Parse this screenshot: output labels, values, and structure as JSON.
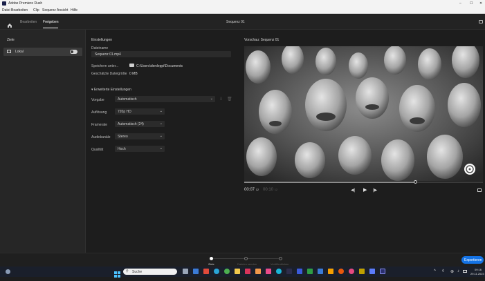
{
  "window": {
    "title": "Adobe Premiere Rush",
    "controls": {
      "minimize": "–",
      "maximize": "☐",
      "close": "✕"
    }
  },
  "menu": [
    "Datei",
    "Bearbeiten",
    "Clip",
    "Sequenz",
    "Ansicht",
    "Hilfe"
  ],
  "header": {
    "tabs": [
      "Bearbeiten",
      "Freigeben"
    ],
    "active_tab": "Freigeben",
    "sequence_title": "Sequenz 01"
  },
  "sidebar": {
    "heading": "Ziele",
    "items": [
      {
        "label": "Lokal",
        "toggle_on": true
      }
    ]
  },
  "settings": {
    "heading": "Einstellungen",
    "filename_label": "Dateiname",
    "filename_value": "Sequenz 01.mp4",
    "save_label": "Speichern unter...",
    "save_path": "C:\\Users\\derdeppi\\Documents",
    "size_label": "Geschätzte Dateigröße",
    "size_value": "0 MB",
    "advanced_label": "Erweiterte Einstellungen",
    "rows": [
      {
        "label": "Vorgabe",
        "value": "Automatisch"
      },
      {
        "label": "Auflösung",
        "value": "720p HD"
      },
      {
        "label": "Framerate",
        "value": "Automatisch (24)"
      },
      {
        "label": "Audiokanäle",
        "value": "Stereo"
      },
      {
        "label": "Qualität",
        "value": "Hoch"
      }
    ]
  },
  "preview": {
    "heading": "Vorschau: Sequenz 01",
    "current_time": "00:07",
    "current_frames": "12",
    "total_time": "00:10",
    "total_frames": "12",
    "progress": 0.72
  },
  "footer": {
    "steps": [
      "Ziele",
      "Dateien senden",
      "Veröffentlichen"
    ],
    "active_step": 0,
    "export_label": "Exportieren"
  },
  "taskbar": {
    "search_placeholder": "Suche",
    "time": "09:16",
    "date": "29.11.2023"
  },
  "colors": {
    "accent": "#1473e6",
    "panel": "#262626",
    "background": "#1d1d1d",
    "taskbar": "#1a1f2b"
  }
}
